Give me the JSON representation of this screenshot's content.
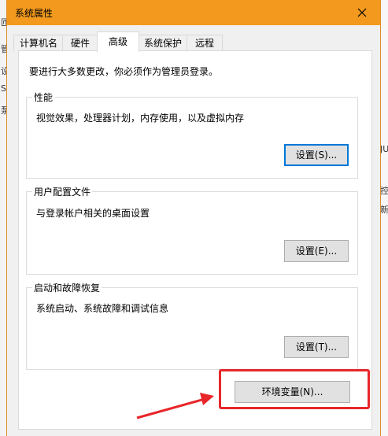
{
  "colors": {
    "titlebar": "#f39a1e",
    "accent_focus": "#0078d7",
    "annotation_red": "#e8262a"
  },
  "background": {
    "left_chars": [
      "匝",
      "管",
      "设",
      "S",
      "泵"
    ],
    "right_chars": [
      "JU",
      "控",
      "新"
    ]
  },
  "dialog": {
    "title": "系统属性",
    "tabs": [
      {
        "label": "计算机名",
        "active": false
      },
      {
        "label": "硬件",
        "active": false
      },
      {
        "label": "高级",
        "active": true
      },
      {
        "label": "系统保护",
        "active": false
      },
      {
        "label": "远程",
        "active": false
      }
    ],
    "notice": "要进行大多数更改，你必须作为管理员登录。",
    "groups": {
      "performance": {
        "legend": "性能",
        "description": "视觉效果，处理器计划，内存使用，以及虚拟内存",
        "button": "设置(S)..."
      },
      "user_profiles": {
        "legend": "用户配置文件",
        "description": "与登录帐户相关的桌面设置",
        "button": "设置(E)..."
      },
      "startup_recovery": {
        "legend": "启动和故障恢复",
        "description": "系统启动、系统故障和调试信息",
        "button": "设置(T)..."
      }
    },
    "env_button": "环境变量(N)..."
  }
}
